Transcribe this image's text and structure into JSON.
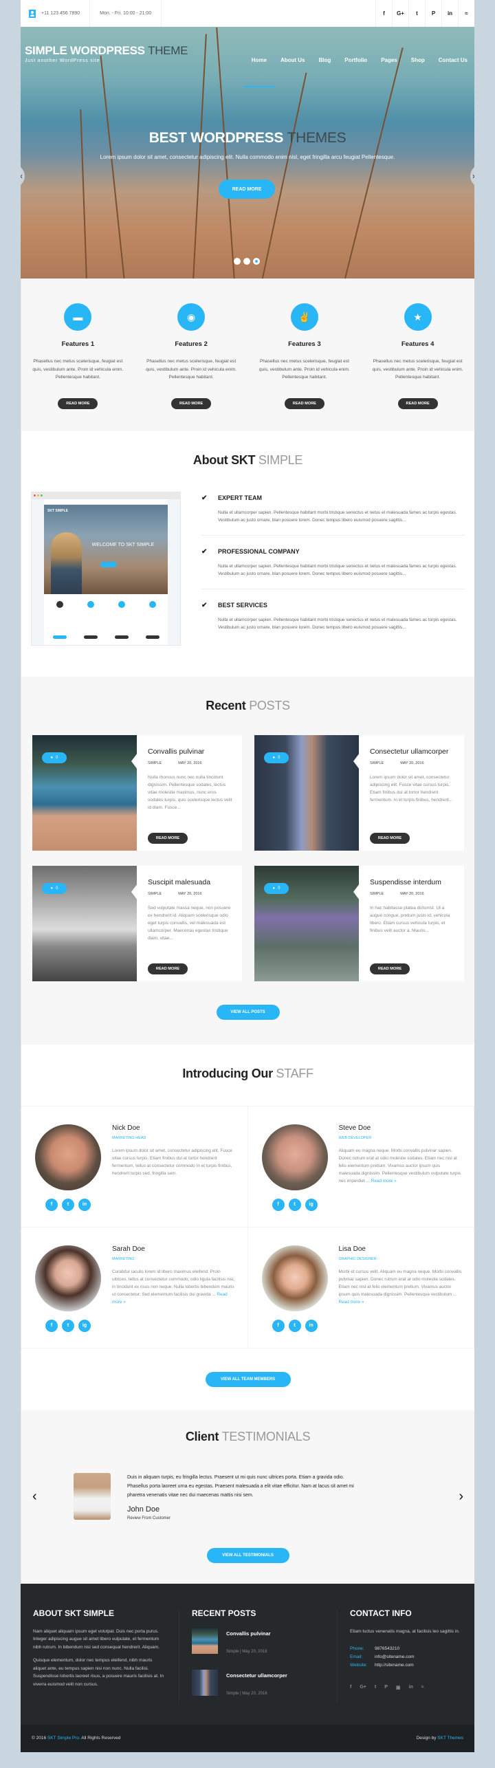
{
  "topbar": {
    "phone": "+11 123 456 7890",
    "hours": "Mon. - Fri. 10:00 - 21:00",
    "social": [
      {
        "icon": "facebook-icon",
        "glyph": "f"
      },
      {
        "icon": "google-plus-icon",
        "glyph": "G+"
      },
      {
        "icon": "twitter-icon",
        "glyph": "t"
      },
      {
        "icon": "pinterest-icon",
        "glyph": "P"
      },
      {
        "icon": "linkedin-icon",
        "glyph": "in"
      },
      {
        "icon": "rss-icon",
        "glyph": "≈"
      }
    ]
  },
  "header": {
    "logo_main": "SIMPLE WORDPRESS",
    "logo_accent": "THEME",
    "tagline": "Just another WordPress site",
    "nav": [
      "Home",
      "About Us",
      "Blog",
      "Portfolio",
      "Pages",
      "Shop",
      "Contact Us"
    ],
    "active_nav": "Home"
  },
  "hero": {
    "title_main": "BEST WORDPRESS",
    "title_accent": "THEMES",
    "subtitle": "Lorem ipsum dolor sit amet, consectetur adipiscing elit. Nulla commodo enim nisl, eget fringilla arcu feugiat Pellentesque.",
    "button": "READ MORE",
    "slide_count": 3,
    "active_slide": 3,
    "prev": "‹",
    "next": "›"
  },
  "features": [
    {
      "title": "Features 1",
      "icon": "monitor-icon",
      "glyph": "▬",
      "text": "Phasellus nec metus scelerisque, feugiat est quis, vestibulum ante. Proin id vehicula enim. Pellentesque habitant.",
      "button": "READ MORE"
    },
    {
      "title": "Features 2",
      "icon": "eye-icon",
      "glyph": "◉",
      "text": "Phasellus nec metus scelerisque, feugiat est quis, vestibulum ante. Proin id vehicula enim. Pellentesque habitant.",
      "button": "READ MORE"
    },
    {
      "title": "Features 3",
      "icon": "thumbs-up-icon",
      "glyph": "✌",
      "text": "Phasellus nec metus scelerisque, feugiat est quis, vestibulum ante. Proin id vehicula enim. Pellentesque habitant.",
      "button": "READ MORE"
    },
    {
      "title": "Features 4",
      "icon": "star-icon",
      "glyph": "★",
      "text": "Phasellus nec metus scelerisque, feugiat est quis, vestibulum ante. Proin id vehicula enim. Pellentesque habitant.",
      "button": "READ MORE"
    }
  ],
  "about": {
    "title_main": "About SKT",
    "title_accent": "SIMPLE",
    "mock": {
      "logo": "SKT SIMPLE",
      "hero_text": "WELCOME TO SKT SIMPLE"
    },
    "items": [
      {
        "title": "EXPERT TEAM",
        "text": "Nulla et ullamcorper sapien. Pellentesque habitant morbi tristique senectus et netus et malesuada fames ac turpis egestas. Vestibulum ac justo ornare, blan posuere lorem. Donec tempus libero euismod posuere sagittis..."
      },
      {
        "title": "PROFESSIONAL COMPANY",
        "text": "Nulla et ullamcorper sapien. Pellentesque habitant morbi tristique senectus et netus et malesuada fames ac turpis egestas. Vestibulum ac justo ornare, blan posuere lorem. Donec tempus libero euismod posuere sagittis..."
      },
      {
        "title": "BEST SERVICES",
        "text": "Nulla et ullamcorper sapien. Pellentesque habitant morbi tristique senectus et netus et malesuada fames ac turpis egestas. Vestibulum ac justo ornare, blan posuere lorem. Donec tempus libero euismod posuere sagittis..."
      }
    ]
  },
  "posts": {
    "title_main": "Recent",
    "title_accent": "POSTS",
    "items": [
      {
        "title": "Convallis pulvinar",
        "author": "SIMPLE",
        "date": "MAY 20, 2016",
        "comments": "0",
        "text": "Nulla rhoncus nunc nec nulla tincidunt dignissim. Pellentesque sodales, lectus vitae molestie maximus, nunc eros sodales turpis, quis scelerisque lectus velit id diam. Fusce...",
        "button": "READ MORE"
      },
      {
        "title": "Consectetur ullamcorper",
        "author": "SIMPLE",
        "date": "MAY 20, 2016",
        "comments": "0",
        "text": "Lorem ipsum dolor sit amet, consectetur adipiscing elit. Fusce vitae cursus turpis. Etiam finibus dui at tortor hendrerit fermentum. In et turpis finibus, hendrerit...",
        "button": "READ MORE"
      },
      {
        "title": "Suscipit malesuada",
        "author": "SIMPLE",
        "date": "MAY 20, 2016",
        "comments": "0",
        "text": "Sed vulputate massa neque, non posuere ex hendrerit id. Aliquam scelerisque odio eget turpis convallis, vel malesuada est ullamcorper. Maecenas egestas tristique diam, vitae...",
        "button": "READ MORE"
      },
      {
        "title": "Suspendisse interdum",
        "author": "SIMPLE",
        "date": "MAY 20, 2016",
        "comments": "0",
        "text": "In hac habitasse platea dictumst. Ut a augue congue, pretium justo id, vehicula libero. Etiam cursus vehicula turpis, et finibus velit auctor a. Mauris...",
        "button": "READ MORE"
      }
    ],
    "view_all": "VIEW ALL POSTS"
  },
  "staff": {
    "title_main": "Introducing Our",
    "title_accent": "STAFF",
    "members": [
      {
        "name": "Nick Doe",
        "role": "MARKETING HEAD",
        "text": "Lorem ipsum dolor sit amet, consectetur adipiscing elit. Fusce vitae cursus turpis. Etiam finibus dui at tortor hendrerit fermentum, tellus at consectetur commodo In et turpis finibus, hendrerit turpis sed, fringilla sem.",
        "read_more": "",
        "social": [
          "f",
          "t",
          "in"
        ]
      },
      {
        "name": "Steve Doe",
        "role": "WEB DEVELOPER",
        "text": "Aliquam eu magna neque. Morbi convallis pulvinar sapien. Donec rutrum erat at odio molestie sodales. Etiam nec nisl at felis elementum pretium. Vivamus auctor ipsum quis malesuada dignissim. Pellentesque vestibulum vulputate turpis nec imperdiet ...",
        "read_more": "Read more »",
        "social": [
          "f",
          "t",
          "ig"
        ]
      },
      {
        "name": "Sarah Doe",
        "role": "MARKETING",
        "text": "Curabitur iaculis lorem id libero maximus eleifend. Proin ultrices, tellus at consectetur commodo, odio ligula facilisis nisi, in tincidunt ex risus non neque. Nulla lobortis bibendum mauris ut consectetur. Sed elementum facilisis dui gravida ...",
        "read_more": "Read more »",
        "social": [
          "f",
          "t",
          "ig"
        ]
      },
      {
        "name": "Lisa Doe",
        "role": "GRAPHIC DESIGNER",
        "text": "Morbi et cursus velit. Aliquam eu magna neque. Morbi convallis pulvinar sapien. Donec rutrum erat at odio molestie sodales. Etiam nec nisl at felis elementum pretium. Vivamus auctor ipsum quis malesuada dignissim. Pellentesque vestibulum ...",
        "read_more": "Read more »",
        "social": [
          "f",
          "t",
          "in"
        ]
      }
    ],
    "view_all": "VIEW ALL TEAM MEMBERS"
  },
  "testimonials": {
    "title_main": "Client",
    "title_accent": "TESTIMONIALS",
    "quote": "Duis in aliquam turpis, eu fringilla lectus. Praesent ut mi quis nunc ultrices porta. Etiam a gravida odio. Phasellus porta laoreet urna eu egestas. Praesent malesuada a elit vitae efficitur. Nam at lacus sit amet mi pharetra venenatis vitae nec dui maecenas mattis nisi sem.",
    "name": "John Doe",
    "subtitle": "Review From Customer",
    "prev": "‹",
    "next": "›",
    "view_all": "VIEW ALL TESTIMONIALS"
  },
  "footer": {
    "about_title": "ABOUT SKT SIMPLE",
    "about_p1": "Nam aliquet aliquam ipsum eget volutpat. Duis nec porta purus. Integer adipiscing augue sit amet libero vulputate, et fermentum nibh rutrum. In bibendum nisi sed consequat hendrerit. Aliquam.",
    "about_p2": "Quisque elementum, dolor nec tempus eleifend, nibh mauris aliquet ante, eu tempus sapien nisi non nunc. Nulla facilisi. Suspendisse lobortis laoreet risus, a posuere mauris facilisis at. In viverra euismod velit non cursus.",
    "posts_title": "RECENT POSTS",
    "posts": [
      {
        "title": "Convallis pulvinar",
        "meta": "Simple  |  May 20, 2016"
      },
      {
        "title": "Consectetur ullamcorper",
        "meta": "Simple  |  May 20, 2016"
      }
    ],
    "contact_title": "CONTACT INFO",
    "contact_text": "Etiam luctus venenatis magna, at facilisis leo sagittis in.",
    "contact": [
      {
        "label": "Phone:",
        "value": "9876543210"
      },
      {
        "label": "Email:",
        "value": "info@sitename.com"
      },
      {
        "label": "Website:",
        "value": "http://sitename.com"
      }
    ],
    "social": [
      "f",
      "G+",
      "t",
      "P",
      "▣",
      "in",
      "≈"
    ],
    "copyright_prefix": "© 2016",
    "copyright_link": "SKT Simple Pro.",
    "copyright_suffix": "All Rights Reserved",
    "design_prefix": "Design by",
    "design_link": "SKT Themes"
  },
  "colors": {
    "accent": "#29b6f6",
    "dark_button": "#333333",
    "footer_bg": "#25292b"
  }
}
